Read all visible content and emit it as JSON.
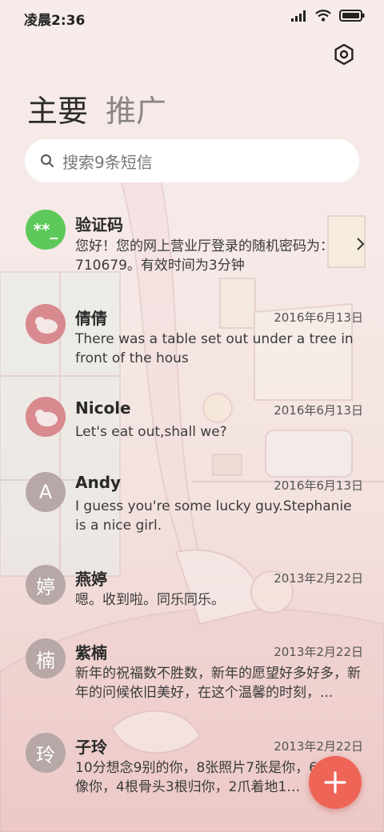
{
  "status": {
    "time": "凌晨2:36"
  },
  "tabs": [
    {
      "label": "主要",
      "active": true
    },
    {
      "label": "推广",
      "active": false
    }
  ],
  "search": {
    "placeholder": "搜索9条短信"
  },
  "messages": [
    {
      "sender": "验证码",
      "date": "",
      "preview": "您好！您的网上营业厅登录的随机密码为：710679。有效时间为3分钟",
      "avatar_text": "**_",
      "avatar_color": "#5dc95a"
    },
    {
      "sender": "倩倩",
      "date": "2016年6月13日",
      "preview": "There was a table set out under a tree in front of the hous",
      "avatar_text": "",
      "avatar_color": "#d98a8e"
    },
    {
      "sender": "Nicole",
      "date": "2016年6月13日",
      "preview": "Let's eat out,shall we?",
      "avatar_text": "",
      "avatar_color": "#d98a8e"
    },
    {
      "sender": "Andy",
      "date": "2016年6月13日",
      "preview": "I guess you're some lucky guy.Stephanie is a nice girl.",
      "avatar_text": "A",
      "avatar_color": "#b7a7a7"
    },
    {
      "sender": "燕婷",
      "date": "2013年2月22日",
      "preview": "嗯。收到啦。同乐同乐。",
      "avatar_text": "婷",
      "avatar_color": "#b7a7a7"
    },
    {
      "sender": "紫楠",
      "date": "2013年2月22日",
      "preview": "新年的祝福数不胜数，新年的愿望好多好多，新年的问候依旧美好，在这个温馨的时刻，...",
      "avatar_text": "楠",
      "avatar_color": "#b7a7a7"
    },
    {
      "sender": "子玲",
      "date": "2013年2月22日",
      "preview": "10分想念9别的你，8张照片7张是你，6…5只像你，4根骨头3根归你，2爪着地1…",
      "avatar_text": "玲",
      "avatar_color": "#b7a7a7"
    }
  ],
  "fab": {
    "label": "+"
  },
  "colors": {
    "accent": "#ee6557",
    "verify_avatar": "#5dc95a",
    "letter_avatar": "#b7a7a7"
  }
}
